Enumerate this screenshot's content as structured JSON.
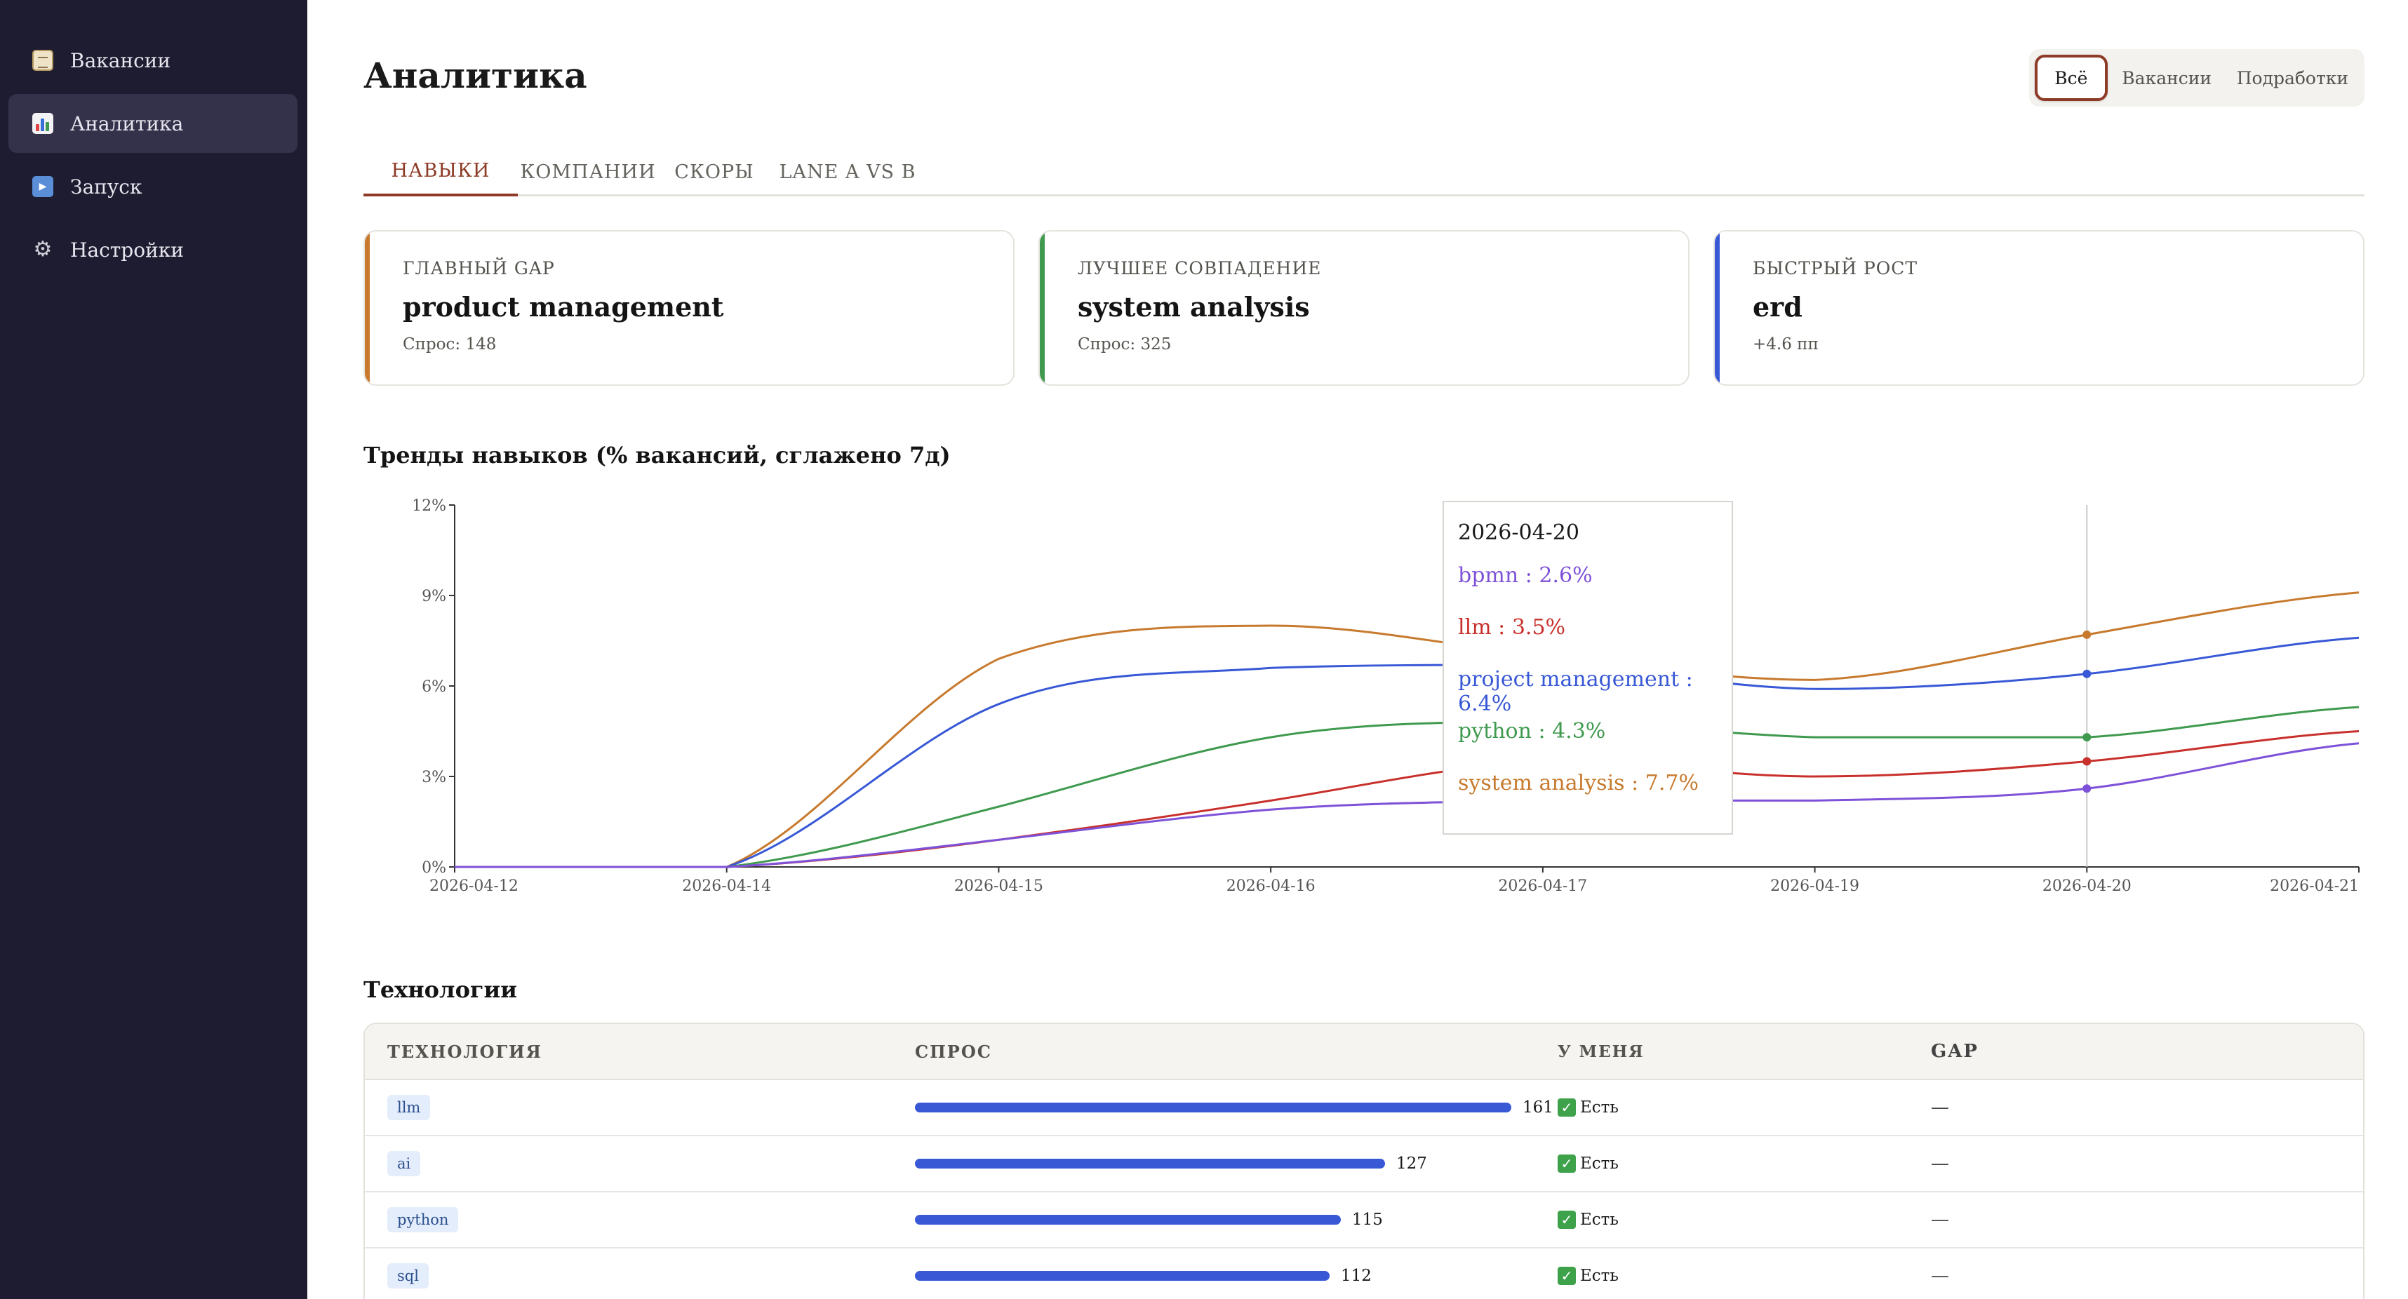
{
  "sidebar": {
    "items": [
      {
        "label": "Вакансии",
        "icon": "clipboard-icon"
      },
      {
        "label": "Аналитика",
        "icon": "bar-chart-icon"
      },
      {
        "label": "Запуск",
        "icon": "play-icon"
      },
      {
        "label": "Настройки",
        "icon": "gear-icon"
      }
    ]
  },
  "page": {
    "title": "Аналитика"
  },
  "filter": {
    "all": "Всё",
    "vacancies": "Вакансии",
    "side": "Подработки"
  },
  "tabs": [
    "НАВЫКИ",
    "КОМПАНИИ",
    "СКОРЫ",
    "LANE A VS B"
  ],
  "cards": [
    {
      "label": "ГЛАВНЫЙ GAP",
      "value": "product management",
      "sub": "Спрос: 148",
      "accent": "#c77a2e"
    },
    {
      "label": "ЛУЧШЕЕ СОВПАДЕНИЕ",
      "value": "system analysis",
      "sub": "Спрос: 325",
      "accent": "#3f9a4f"
    },
    {
      "label": "БЫСТРЫЙ РОСТ",
      "value": "erd",
      "sub": "+4.6 пп",
      "accent": "#3858d6"
    }
  ],
  "trends": {
    "title": "Тренды навыков (% вакансий, сглажено 7д)"
  },
  "tooltip": {
    "date": "2026-04-20",
    "rows": [
      {
        "text": "bpmn : 2.6%",
        "color": "#7e52d8"
      },
      {
        "text": "llm : 3.5%",
        "color": "#c8302c"
      },
      {
        "text": "project management : 6.4%",
        "color": "#3858d6"
      },
      {
        "text": "python : 4.3%",
        "color": "#3f9a4f"
      },
      {
        "text": "system analysis : 7.7%",
        "color": "#c77a2e"
      }
    ]
  },
  "chart_data": {
    "type": "line",
    "title": "Тренды навыков (% вакансий, сглажено 7д)",
    "x": [
      "2026-04-12",
      "2026-04-14",
      "2026-04-15",
      "2026-04-16",
      "2026-04-17",
      "2026-04-19",
      "2026-04-20",
      "2026-04-21"
    ],
    "ylim": [
      0,
      12
    ],
    "yticks": [
      "0%",
      "3%",
      "6%",
      "9%",
      "12%"
    ],
    "ytick_values": [
      0,
      3,
      6,
      9,
      12
    ],
    "series": [
      {
        "name": "system analysis",
        "color": "#c77a2e",
        "values": [
          0,
          0,
          6.9,
          8.0,
          7.0,
          6.2,
          7.7,
          9.1
        ]
      },
      {
        "name": "project management",
        "color": "#3858d6",
        "values": [
          0,
          0,
          5.4,
          6.6,
          6.7,
          5.9,
          6.4,
          7.6
        ]
      },
      {
        "name": "python",
        "color": "#3f9a4f",
        "values": [
          0,
          0,
          2.0,
          4.3,
          4.8,
          4.3,
          4.3,
          5.3
        ]
      },
      {
        "name": "llm",
        "color": "#c8302c",
        "values": [
          0,
          0,
          0.9,
          2.2,
          3.5,
          3.0,
          3.5,
          4.5
        ]
      },
      {
        "name": "bpmn",
        "color": "#7e52d8",
        "values": [
          0,
          0,
          0.9,
          1.9,
          2.2,
          2.2,
          2.6,
          4.1
        ]
      }
    ],
    "highlight_x": "2026-04-20",
    "grid": false
  },
  "tech": {
    "title": "Технологии",
    "headers": [
      "ТЕХНОЛОГИЯ",
      "СПРОС",
      "У МЕНЯ",
      "GAP"
    ],
    "max": 161,
    "rows": [
      {
        "name": "llm",
        "demand": 161,
        "have": "Есть",
        "gap": "—"
      },
      {
        "name": "ai",
        "demand": 127,
        "have": "Есть",
        "gap": "—"
      },
      {
        "name": "python",
        "demand": 115,
        "have": "Есть",
        "gap": "—"
      },
      {
        "name": "sql",
        "demand": 112,
        "have": "Есть",
        "gap": "—"
      }
    ]
  }
}
